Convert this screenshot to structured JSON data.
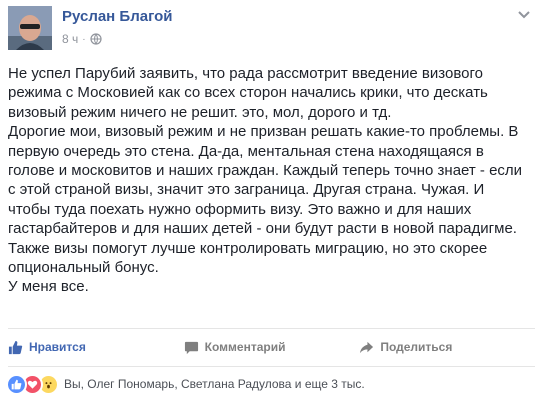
{
  "post": {
    "author": "Руслан Благой",
    "time": "8 ч",
    "separator": "·",
    "paragraphs": [
      "Не успел Парубий заявить, что рада рассмотрит введение визового режима с Московией как со всех сторон начались крики, что дескать визовый режим ничего не решит. это, мол, дорого и тд.",
      "Дорогие мои, визовый режим и не призван решать какие-то проблемы. В первую очередь это стена. Да-да, ментальная стена находящаяся в голове и московитов и наших граждан. Каждый теперь точно знает - если с этой страной визы, значит это заграница. Другая страна. Чужая. И чтобы туда поехать нужно оформить визу. Это важно и для наших гастарбайтеров и для наших детей - они будут расти в новой парадигме. Также визы помогут лучше контролировать миграцию, но это скорее опциональный бонус.",
      "У меня все."
    ]
  },
  "actions": {
    "like": "Нравится",
    "comment": "Комментарий",
    "share": "Поделиться"
  },
  "reactions": {
    "summary": "Вы, Олег Пономарь, Светлана Радулова и еще 3 тыс.",
    "icons": [
      "like-icon",
      "love-icon",
      "wow-icon"
    ]
  },
  "colors": {
    "author": "#365899",
    "like_active": "#4267b2",
    "muted": "#90949c"
  }
}
